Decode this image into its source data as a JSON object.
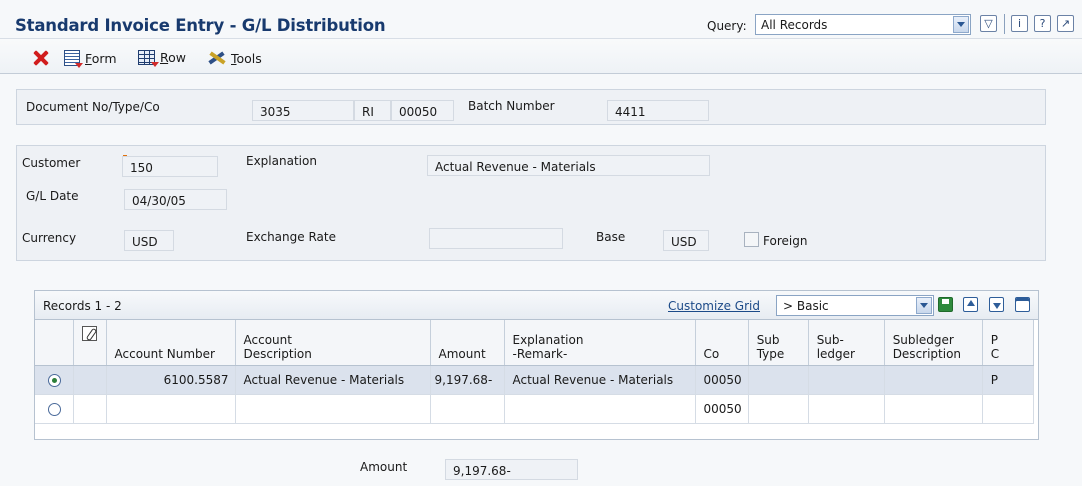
{
  "header": {
    "title": "Standard Invoice Entry - G/L Distribution",
    "query_label": "Query:",
    "query_value": "All Records",
    "icons": [
      "filter-icon",
      "info-icon",
      "help-icon",
      "help-context-icon"
    ]
  },
  "toolbar": {
    "cancel_icon": "close-x-icon",
    "form_label": "Form",
    "row_label": "Row",
    "tools_label": "Tools"
  },
  "document": {
    "label": "Document No/Type/Co",
    "doc_no": "3035",
    "doc_type": "RI",
    "company": "00050",
    "batch_label": "Batch Number",
    "batch_no": "4411"
  },
  "invoice": {
    "customer_label": "Customer",
    "customer_value": "150",
    "explanation_label": "Explanation",
    "explanation_value": "Actual Revenue - Materials",
    "gl_date_label": "G/L Date",
    "gl_date_value": "04/30/05",
    "currency_label": "Currency",
    "currency_value": "USD",
    "exchange_rate_label": "Exchange Rate",
    "exchange_rate_value": "",
    "base_label": "Base",
    "base_value": "USD",
    "foreign_label": "Foreign",
    "foreign_checked": false
  },
  "grid": {
    "records_label": "Records 1 - 2",
    "customize_label": "Customize Grid",
    "format_value": "> Basic",
    "columns": [
      "",
      "",
      "Account Number",
      "Account\nDescription",
      "Amount",
      "Explanation\n-Remark-",
      "Co",
      "Sub\nType",
      "Sub-\nledger",
      "Subledger\nDescription",
      "P\nC"
    ],
    "rows": [
      {
        "selected": true,
        "account_number": "6100.5587",
        "account_description": "Actual Revenue - Materials",
        "amount": "9,197.68-",
        "explanation": "Actual Revenue - Materials",
        "co": "00050",
        "sub_type": "",
        "subledger": "",
        "subledger_description": "",
        "pc": "P"
      },
      {
        "selected": false,
        "account_number": "",
        "account_description": "",
        "amount": "",
        "explanation": "",
        "co": "00050",
        "sub_type": "",
        "subledger": "",
        "subledger_description": "",
        "pc": ""
      }
    ]
  },
  "total": {
    "label": "Amount",
    "value": "9,197.68-"
  },
  "colors": {
    "title": "#183a6e",
    "cancel": "#d11d1d",
    "selected_row": "#dbe2ed",
    "required_marker": "#e0710d"
  }
}
